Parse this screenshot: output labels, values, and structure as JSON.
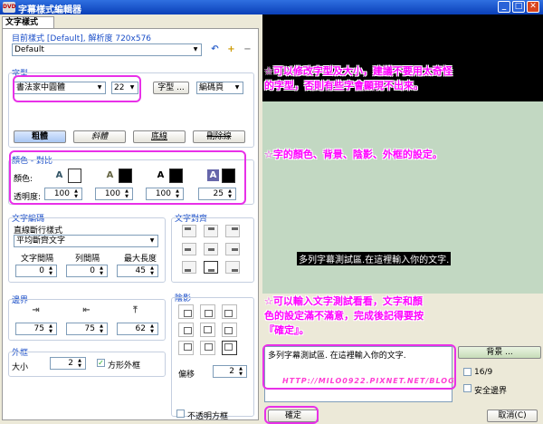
{
  "window": {
    "title": "字幕樣式編輯器",
    "app_icon": "DVD",
    "min": "_",
    "max": "□",
    "close": "✕"
  },
  "panel_tab": "文字樣式",
  "current_style": {
    "label": "目前樣式 [Default], 解析度 720x576",
    "value": "Default"
  },
  "font": {
    "group": "字型",
    "name": "書法家中圓體",
    "size": "22",
    "font_button": "字型 ...",
    "encoding": "編碼頁",
    "bold": "粗體",
    "italic": "斜體",
    "underline": "底線",
    "strike": "刪除線"
  },
  "colors": {
    "group": "顏色 - 對比",
    "color_label": "顏色:",
    "opacity_label": "透明度:",
    "opacity": [
      "100",
      "100",
      "100",
      "25"
    ],
    "swatches": [
      "#ffffff",
      "#000000",
      "#000000",
      "#000000"
    ]
  },
  "layout": {
    "group": "文字編碼",
    "wrap_label": "直線斷行樣式",
    "wrap_value": "平均斷齊文字",
    "char_spacing_label": "文字間隔",
    "line_spacing_label": "列間隔",
    "max_length_label": "最大長度",
    "char_spacing": "0",
    "line_spacing": "0",
    "max_length": "45"
  },
  "alignment": {
    "group": "文字對齊"
  },
  "margins": {
    "group": "邊界",
    "values": [
      "75",
      "75",
      "62"
    ]
  },
  "outline": {
    "group": "外框",
    "size_label": "大小",
    "size": "2",
    "square_label": "方形外框"
  },
  "shadow": {
    "group": "陰影",
    "offset_label": "偏移",
    "offset": "2",
    "opaque_label": "不透明方框"
  },
  "preview": {
    "sample_overlay": "多列字幕測試區.在這裡輸入你的文字.",
    "sample_text": "多列字幕測試區. 在這裡輸入你的文字.",
    "background_button": "背景 ...",
    "ratio_label": "16/9",
    "safe_label": "安全邊界",
    "ok": "確定",
    "cancel": "取消(C)"
  },
  "annotations": {
    "a1_line1": "☆可以修改字型及大小，建議不要用太奇怪",
    "a1_line2": "的字型，否則有些字會顯現不出來。",
    "a2": "☆字的顏色、背景、陰影、外框的設定。",
    "a3_line1": "☆可以輸入文字測試看看，文字和顏",
    "a3_line2": "色的設定滿不滿意，完成後記得要按",
    "a3_line3": "『確定』。",
    "watermark": "HTTP://MILO0922.PIXNET.NET/BLOG"
  },
  "accent_colors": {
    "highlight": "#e830e8",
    "title_bar": "#0a3fb8"
  }
}
